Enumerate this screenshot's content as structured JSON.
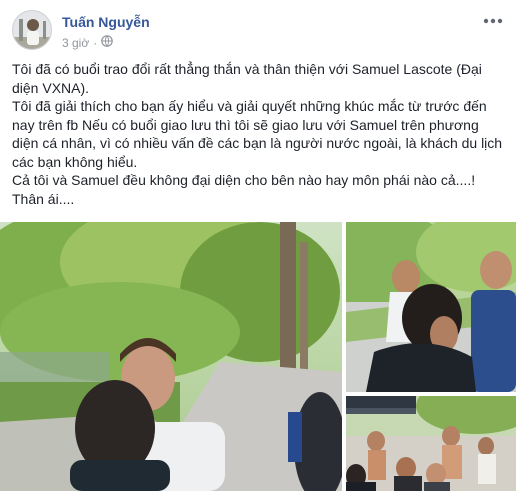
{
  "post": {
    "author_name": "Tuấn Nguyễn",
    "timestamp": "3 giờ",
    "privacy": "globe-icon",
    "more_icon": "more-horizontal-icon",
    "text_paragraphs": [
      "Tôi đã có buổi trao đổi rất thẳng thắn và thân thiện với Samuel Lascote (Đại diện VXNA).",
      "Tôi đã giải thích cho bạn ấy hiểu và giải quyết những khúc mắc từ trước đến nay trên fb Nếu có buổi giao lưu thì tôi sẽ giao lưu với Samuel trên phương diện cá nhân, vì có nhiều vấn đề các bạn là người nước ngoài, là khách du lịch các bạn không hiểu.",
      "Cả tôi và Samuel đều không đại diện cho bên nào hay môn phái nào cả....!",
      "Thân ái...."
    ],
    "colors": {
      "name": "#365899",
      "meta": "#90949c",
      "text": "#1d2129"
    }
  }
}
